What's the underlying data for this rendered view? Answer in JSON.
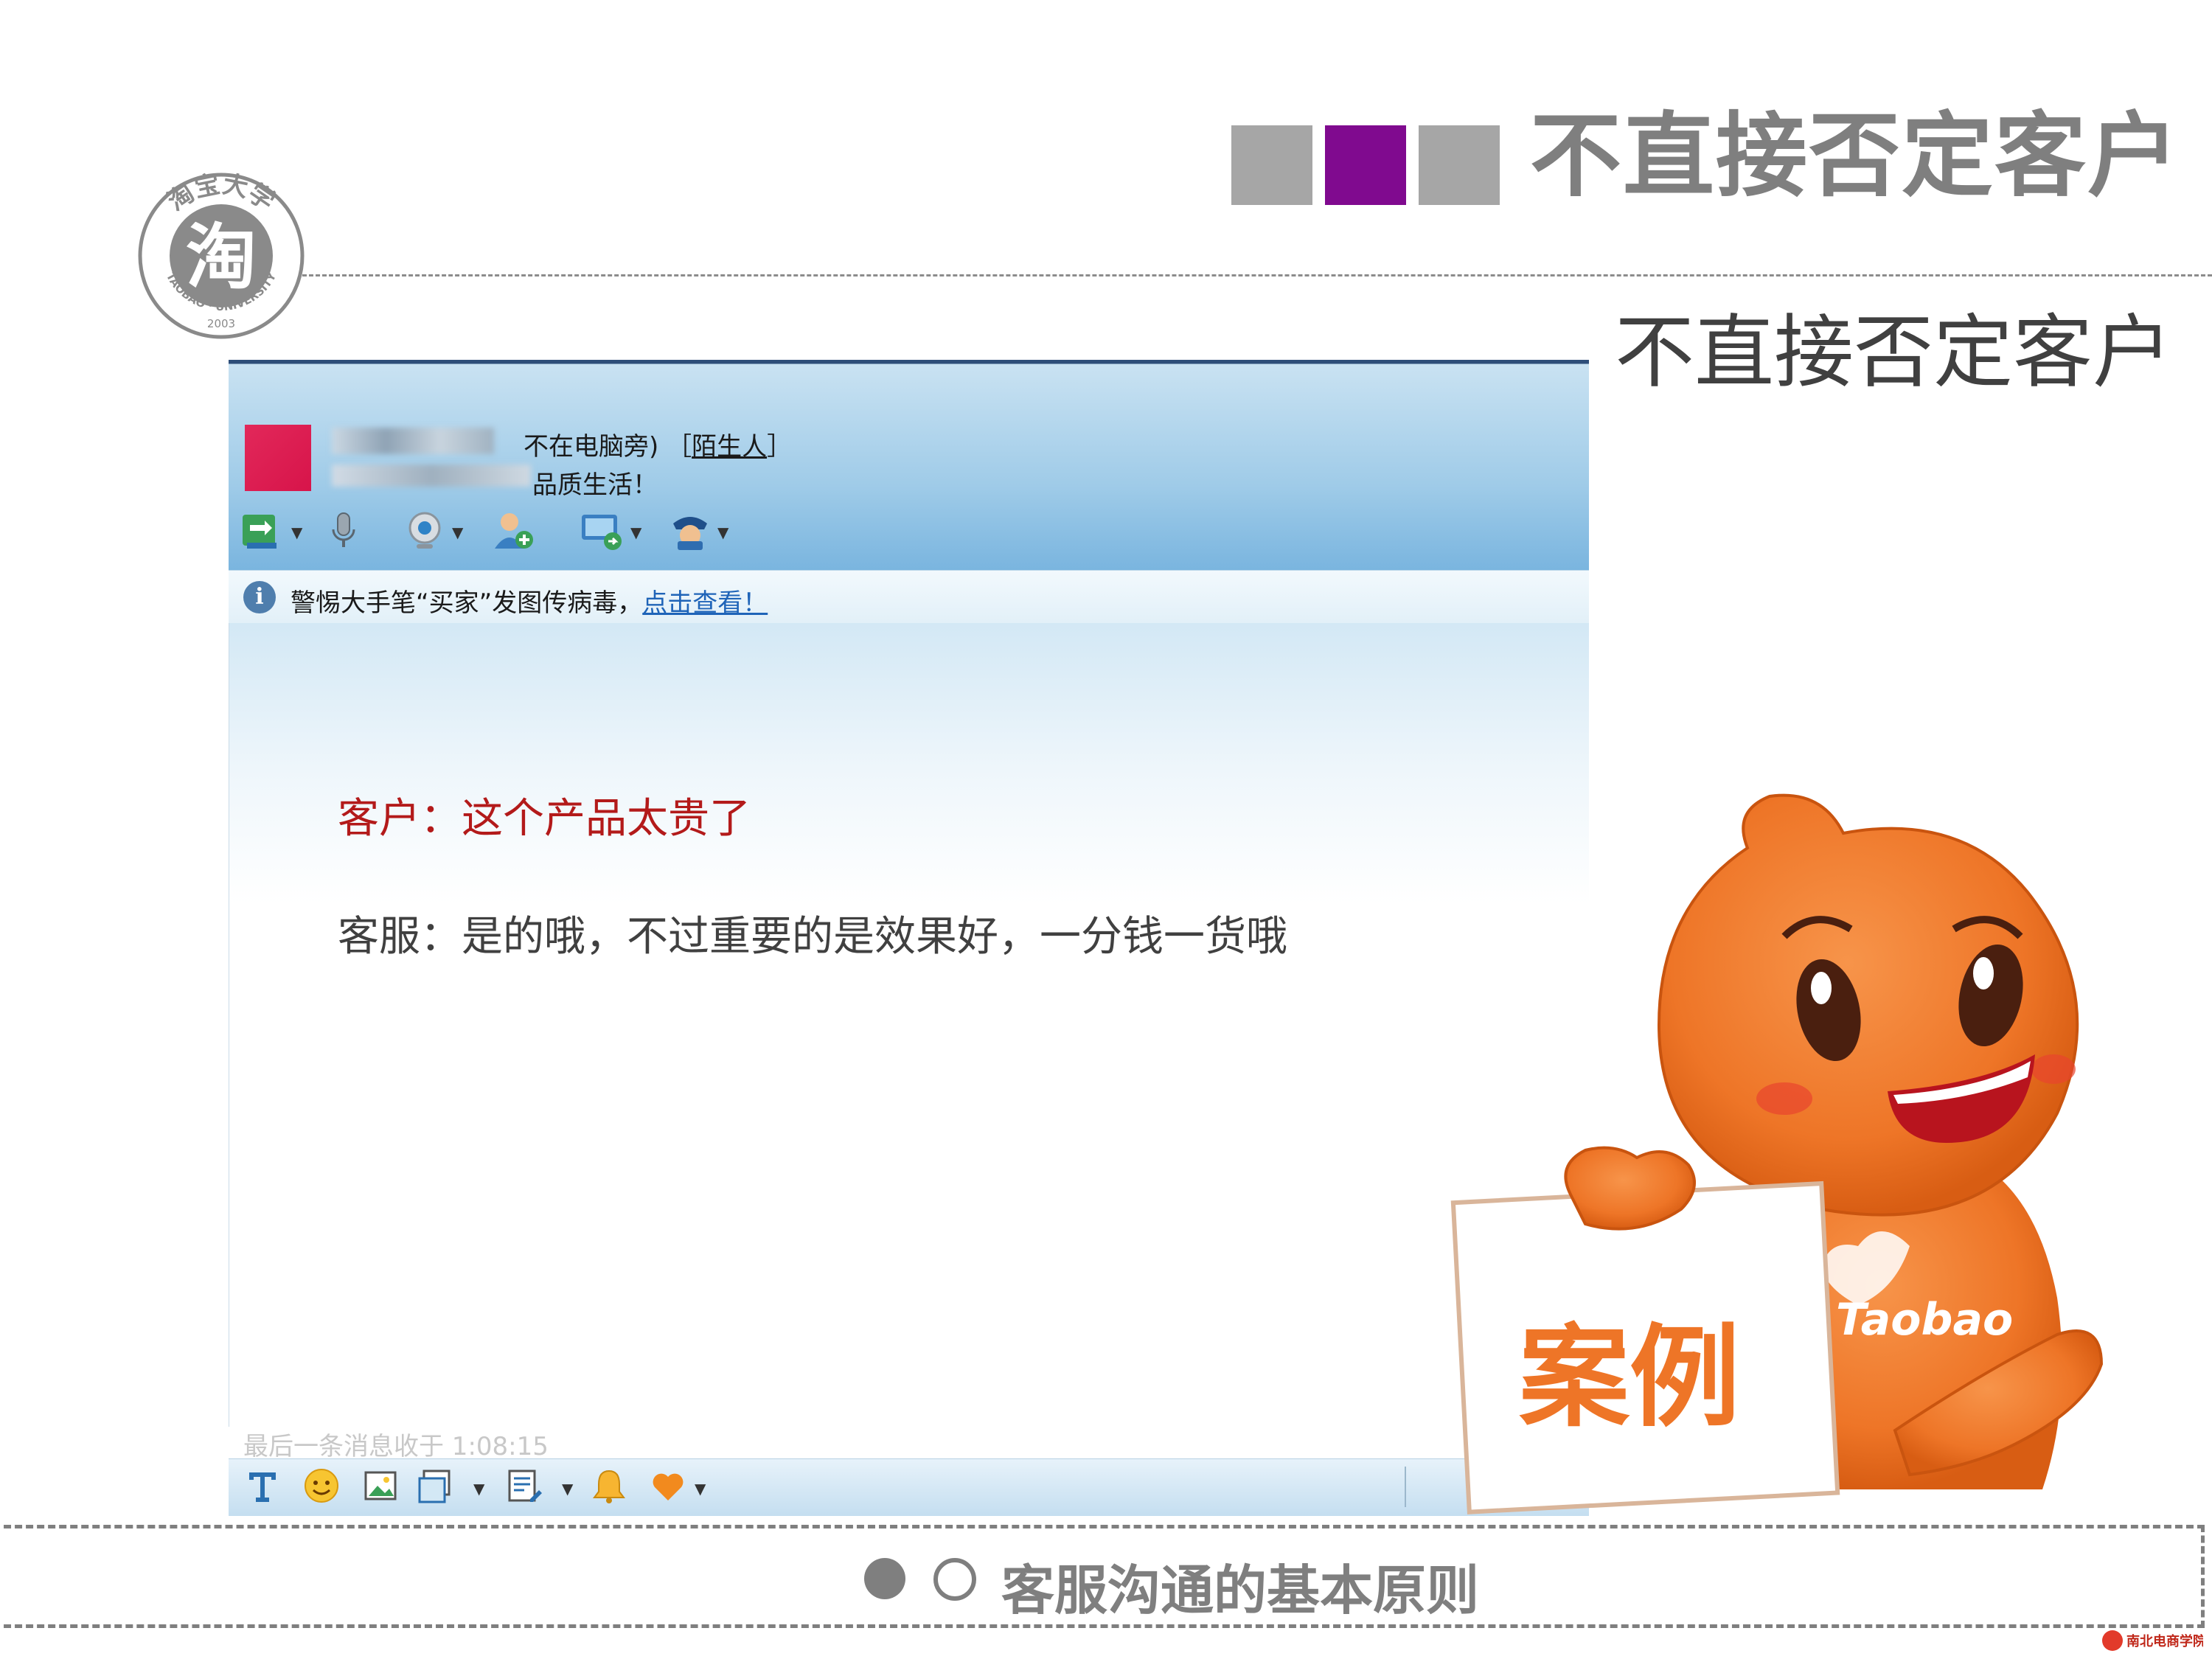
{
  "header": {
    "title": "不直接否定客户",
    "squares": [
      {
        "color": "#a6a6a6"
      },
      {
        "color": "#800a8f"
      },
      {
        "color": "#a6a6a6"
      }
    ]
  },
  "subtitle": "不直接否定客户",
  "logo": {
    "center_char": "淘",
    "ring_cn": "淘宝大学",
    "ring_en": "TAOBAO · UNIVERSITY",
    "year": "2003"
  },
  "chat_window": {
    "status_text": "不在电脑旁)",
    "relation_label": "陌生人",
    "signature_fragment": "品质生活！",
    "toolbar_icons": [
      "transfer-file-icon",
      "voice-call-icon",
      "video-camera-icon",
      "add-contact-icon",
      "remote-assist-icon",
      "security-guard-icon"
    ],
    "notice": {
      "text": "警惕大手笔“买家”发图传病毒，",
      "link": "点击查看！"
    },
    "messages": [
      {
        "speaker": "客户",
        "text": "客户：这个产品太贵了",
        "color": "#b31a1a"
      },
      {
        "speaker": "客服",
        "text": "客服：是的哦，不过重要的是效果好，一分钱一货哦",
        "color": "#404040"
      }
    ],
    "last_message_info": "最后一条消息收于 1:08:15",
    "bottom_icons": [
      "font-icon",
      "emoji-icon",
      "image-icon",
      "screenshot-icon",
      "quick-phrase-icon",
      "shake-icon",
      "heart-icon"
    ]
  },
  "mascot": {
    "sign_text": "案例",
    "shirt_text": "Taobao"
  },
  "footer": {
    "text": "客服沟通的基本原则"
  },
  "corner_logo_text": "南北电商学院"
}
